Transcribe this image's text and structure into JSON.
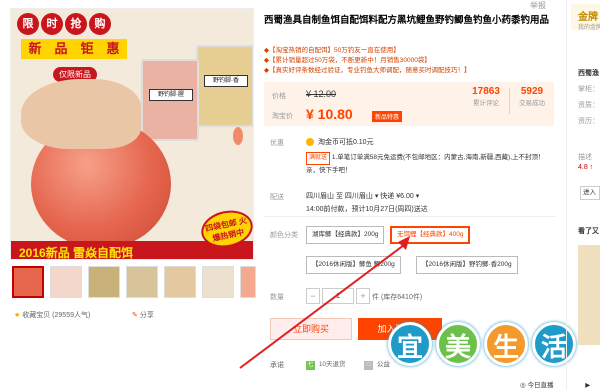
{
  "page": {
    "report_label": "举报"
  },
  "gallery": {
    "banner_chars": [
      "限",
      "时",
      "抢",
      "购",
      "新",
      "品",
      "钜",
      "惠"
    ],
    "new_tag": "仅限新品",
    "pack_labels": [
      "野钓脚·腥",
      "野钓脚·香"
    ],
    "bottom_text": "2016新品  雷焱自配饵",
    "free_ship": "四袋包邮 火爆热销中",
    "thumbs_count": 7,
    "favorite": "收藏宝贝 (29559人气)",
    "share": "分享"
  },
  "product": {
    "title": "西蜀渔具自制鱼饵自配饵料配方黑坑鲤鱼野钓鲫鱼钓鱼小药黍钓用品",
    "subtitle_lines": [
      "◆【淘宝热销的自配饵】50万钓友一直在使用】",
      "◆【累计销量超过50万袋，不断更新中！月销售30000袋】",
      "◆【真实好评条数经过验证，专业钓鱼大师调配，随意买时调配技巧！】"
    ],
    "price_label": "价格",
    "orig_price": "¥ 12.00",
    "promo_label": "淘宝价",
    "promo_price": "¥ 10.80",
    "promo_tag": "新品特惠",
    "stats": [
      {
        "value": "17863",
        "label": "累计评论"
      },
      {
        "value": "5929",
        "label": "交易成功"
      }
    ],
    "benefit_label": "优惠",
    "coin_text": "淘金币可抵0.10元",
    "promo_tag_line": "满就送",
    "promo_text": "1.单笔订单满58元免运费(不包邮地区：内蒙古,海南,新疆,西藏),上不封顶！亲，快下手吧！",
    "shipping_label": "配送",
    "shipping_text": "四川眉山 至  四川眉山 ▾  快递 ¥6.00 ▾",
    "shipping_time": "14:00前付款，预计10月27日(周四)送达",
    "color_label": "颜色分类",
    "options": [
      {
        "text": "湖库鲫【经典款】200g",
        "selected": false
      },
      {
        "text": "无饵鲤【经典款】400g",
        "selected": true
      },
      {
        "text": "【2016休闲版】鲫鱼  鲫200g",
        "selected": false
      },
      {
        "text": "【2016休闲版】野钓鲫·香200g",
        "selected": false
      }
    ],
    "qty_label": "数量",
    "qty_minus": "−",
    "qty_value": "1",
    "qty_plus": "+",
    "stock": "件 (库存6410件)",
    "buy_now": "立即购买",
    "add_cart": "加入购物车",
    "commit_label": "承诺",
    "commit_items": [
      "10天退货",
      "公益"
    ]
  },
  "watermark": {
    "chars": [
      "宜",
      "美",
      "生",
      "活"
    ]
  },
  "sidebar": {
    "shop_name": "金牌",
    "shop_sub": "我的金牌",
    "shop": "西蜀渔",
    "rows": [
      "掌柜：",
      "资质：",
      "资历：",
      "描述"
    ],
    "rating": "4.8 ↑",
    "enter_btn": "进入",
    "see_more": "看了又"
  },
  "footer": {
    "live": "◎ 今日直播",
    "more": "▶"
  }
}
